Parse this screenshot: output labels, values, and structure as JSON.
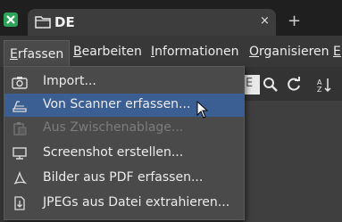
{
  "tab": {
    "title": "DE",
    "close": "×",
    "new_tab": "+"
  },
  "menubar": {
    "items": [
      {
        "label": "Erfassen",
        "u": "E",
        "rest": "rfassen"
      },
      {
        "label": "Bearbeiten",
        "u": "B",
        "rest": "earbeiten"
      },
      {
        "label": "Informationen",
        "u": "I",
        "rest": "nformationen"
      },
      {
        "label": "Organisieren",
        "u": "O",
        "rest": "rganisieren"
      },
      {
        "label": "E",
        "u": "E",
        "rest": ""
      }
    ]
  },
  "toolbar": {
    "search_fragment": "E"
  },
  "dropdown": {
    "items": [
      {
        "label": "Import...",
        "icon": "camera-icon",
        "enabled": true
      },
      {
        "label": "Von Scanner erfassen...",
        "icon": "scanner-icon",
        "enabled": true,
        "highlighted": true
      },
      {
        "label": "Aus Zwischenablage...",
        "icon": "clipboard-icon",
        "enabled": false
      },
      {
        "label": "Screenshot erstellen...",
        "icon": "monitor-icon",
        "enabled": true
      },
      {
        "label": "Bilder aus PDF erfassen...",
        "icon": "pdf-icon",
        "enabled": true
      },
      {
        "label": "JPEGs aus Datei extrahieren...",
        "icon": "file-export-icon",
        "enabled": true
      }
    ]
  },
  "colors": {
    "highlight": "#3b5f93",
    "app_icon": "#2fa35a"
  }
}
